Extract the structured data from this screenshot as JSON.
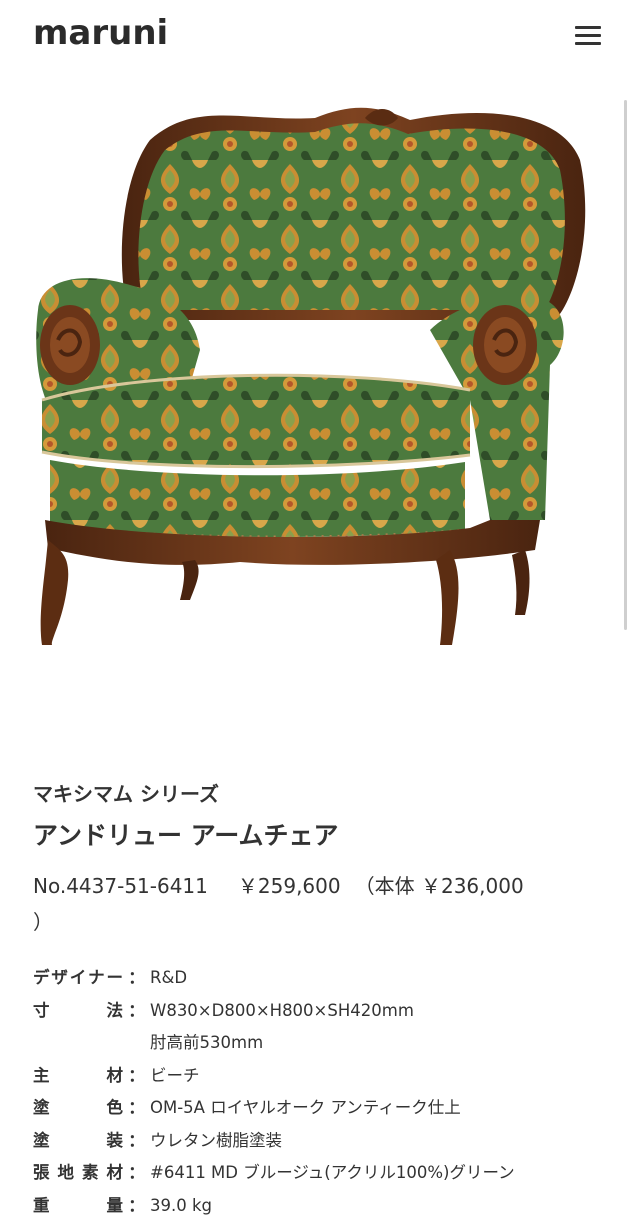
{
  "header": {
    "logo_text": "maruni",
    "menu_icon": "hamburger-menu-icon"
  },
  "product": {
    "series": "マキシマム シリーズ",
    "name": "アンドリュー アームチェア",
    "number": "No.4437-51-6411",
    "price": "￥259,600",
    "price_body": "（本体 ￥236,000",
    "price_close": "）"
  },
  "specs": [
    {
      "label_chars": [
        "デ",
        "ザ",
        "イ",
        "ナ",
        "ー"
      ],
      "value": "R&D"
    },
    {
      "label_chars": [
        "寸",
        "法"
      ],
      "value": "W830×D800×H800×SH420mm",
      "value2": "肘高前530mm"
    },
    {
      "label_chars": [
        "主",
        "材"
      ],
      "value": "ビーチ"
    },
    {
      "label_chars": [
        "塗",
        "色"
      ],
      "value": "OM-5A ロイヤルオーク アンティーク仕上"
    },
    {
      "label_chars": [
        "塗",
        "装"
      ],
      "value": "ウレタン樹脂塗装"
    },
    {
      "label_chars": [
        "張",
        "地",
        "素",
        "材"
      ],
      "value": "#6411 MD ブルージュ(アクリル100%)グリーン"
    },
    {
      "label_chars": [
        "重",
        "量"
      ],
      "value": "39.0 kg"
    }
  ],
  "colors": {
    "text": "#333333",
    "wood": "#6b3518",
    "fabric_green": "#4f7a3c",
    "fabric_gold": "#c98e33"
  }
}
